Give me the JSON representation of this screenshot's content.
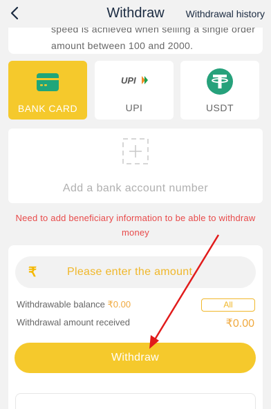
{
  "header": {
    "title": "Withdraw",
    "history_link": "Withdrawal history"
  },
  "notice": {
    "line1": "speed is achieved when selling a single order",
    "line2": "amount between 100 and 2000."
  },
  "methods": [
    {
      "label": "BANK CARD",
      "icon": "bank-card-icon",
      "active": true
    },
    {
      "label": "UPI",
      "icon": "upi-logo-icon",
      "active": false
    },
    {
      "label": "USDT",
      "icon": "tether-icon",
      "active": false
    }
  ],
  "add_bank": {
    "label": "Add a bank account number",
    "icon": "add-plus-icon"
  },
  "warning": "Need to add beneficiary information to be able to withdraw money",
  "amount": {
    "placeholder": "Please enter the amount",
    "currency_symbol": "₹",
    "withdrawable_label": "Withdrawable balance",
    "withdrawable_value": "₹0.00",
    "all_label": "All",
    "received_label": "Withdrawal amount received",
    "received_value": "₹0.00",
    "withdraw_button": "Withdraw"
  },
  "colors": {
    "accent": "#f5c92c",
    "warning": "#e84a4a",
    "tether_green": "#26a17b",
    "annotation_arrow": "#e11b1b"
  },
  "upi_logo_text": "UPI"
}
